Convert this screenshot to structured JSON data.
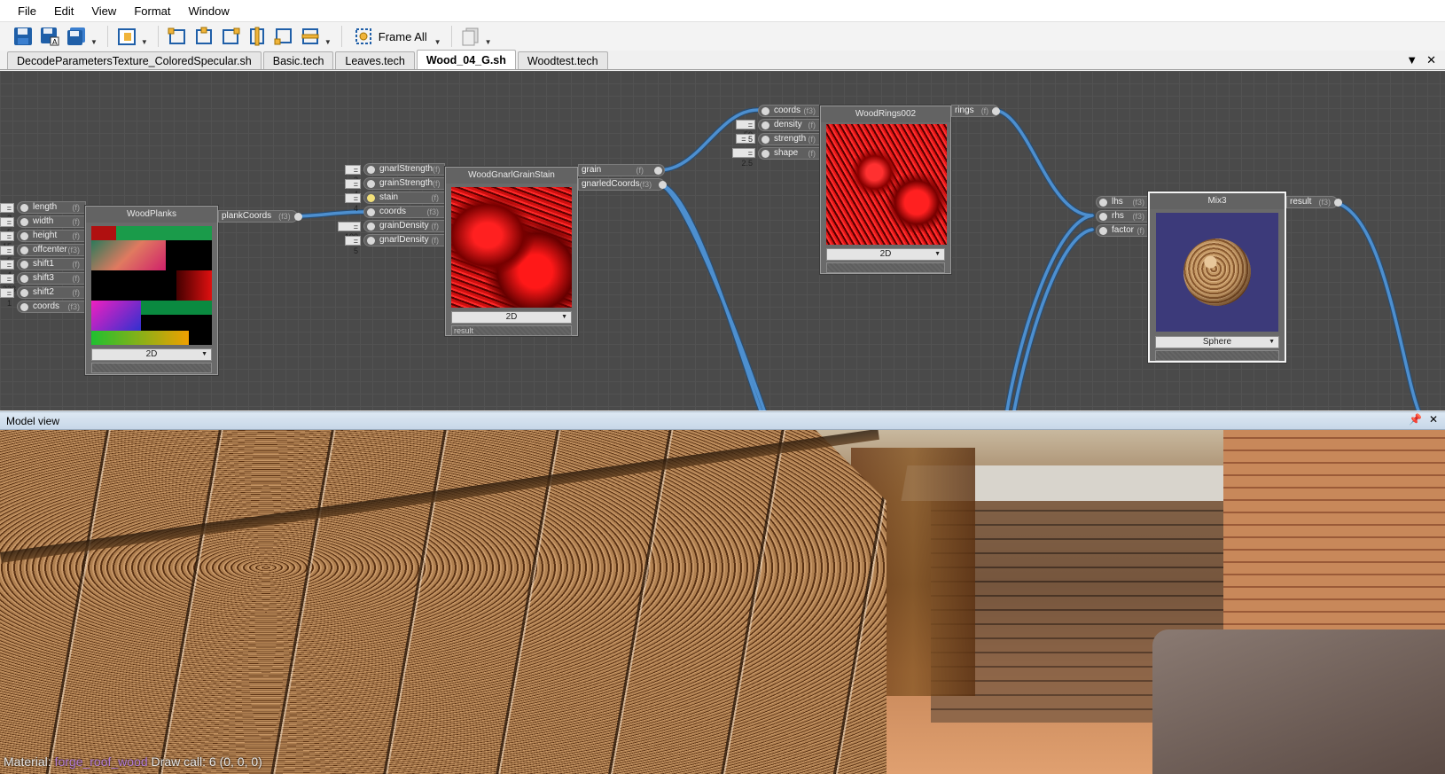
{
  "menu": [
    "File",
    "Edit",
    "View",
    "Format",
    "Window"
  ],
  "toolbar": {
    "frame_all_label": "Frame All"
  },
  "tabs": [
    {
      "label": "DecodeParametersTexture_ColoredSpecular.sh",
      "active": false
    },
    {
      "label": "Basic.tech",
      "active": false
    },
    {
      "label": "Leaves.tech",
      "active": false
    },
    {
      "label": "Wood_04_G.sh",
      "active": true
    },
    {
      "label": "Woodtest.tech",
      "active": false
    }
  ],
  "graph": {
    "nodes": {
      "woodplanks": {
        "title": "WoodPlanks",
        "inputs": [
          {
            "name": "length",
            "type": "(f)",
            "value": "2"
          },
          {
            "name": "width",
            "type": "(f)",
            "value": "5"
          },
          {
            "name": "height",
            "type": "(f)",
            "value": "15"
          },
          {
            "name": "offcenter",
            "type": "(f3)",
            "value": "5"
          },
          {
            "name": "shift1",
            "type": "(f)",
            "value": "4"
          },
          {
            "name": "shift3",
            "type": "(f)",
            "value": "333"
          },
          {
            "name": "shift2",
            "type": "(f)",
            "value": "1"
          },
          {
            "name": "coords",
            "type": "(f3)",
            "value": ""
          }
        ],
        "output": {
          "name": "plankCoords",
          "type": "(f3)"
        },
        "dropdown": "2D"
      },
      "gnarl": {
        "title": "WoodGnarlGrainStain",
        "inputs": [
          {
            "name": "gnarlStrength",
            "type": "(f)",
            "value": "2"
          },
          {
            "name": "grainStrength",
            "type": "(f)",
            "value": "4"
          },
          {
            "name": "stain",
            "type": "(f)",
            "value": "4"
          },
          {
            "name": "coords",
            "type": "(f3)",
            "value": ""
          },
          {
            "name": "grainDensity",
            "type": "(f)",
            "value": "100"
          },
          {
            "name": "gnarlDensity",
            "type": "(f)",
            "value": "5"
          }
        ],
        "outputs": [
          {
            "name": "grain",
            "type": "(f)"
          },
          {
            "name": "gnarledCoords",
            "type": "(f3)"
          }
        ],
        "dropdown": "2D",
        "bar_label": "result"
      },
      "rings": {
        "title": "WoodRings002",
        "inputs": [
          {
            "name": "coords",
            "type": "(f3)",
            "value": ""
          },
          {
            "name": "density",
            "type": "(f)",
            "value": "50"
          },
          {
            "name": "strength",
            "type": "(f)",
            "value": "5"
          },
          {
            "name": "shape",
            "type": "(f)",
            "value": "2.5"
          }
        ],
        "output": {
          "name": "rings",
          "type": "(f)"
        },
        "dropdown": "2D"
      },
      "mix": {
        "title": "Mix3",
        "inputs": [
          {
            "name": "lhs",
            "type": "(f3)",
            "value": ""
          },
          {
            "name": "rhs",
            "type": "(f3)",
            "value": ""
          },
          {
            "name": "factor",
            "type": "(f)",
            "value": ""
          }
        ],
        "output": {
          "name": "result",
          "type": "(f3)"
        },
        "dropdown": "Sphere"
      }
    }
  },
  "model_view": {
    "title": "Model view",
    "status_prefix": "Material:",
    "material_name": "forge_roof_wood",
    "status_suffix": "Draw call: 6 (0, 0, 0)"
  },
  "colors": {
    "wire": "#4d8fcf",
    "graph_bg": "#4a4a4a",
    "header_blue": "#c7d7e8",
    "material_name": "#b57cd4"
  }
}
